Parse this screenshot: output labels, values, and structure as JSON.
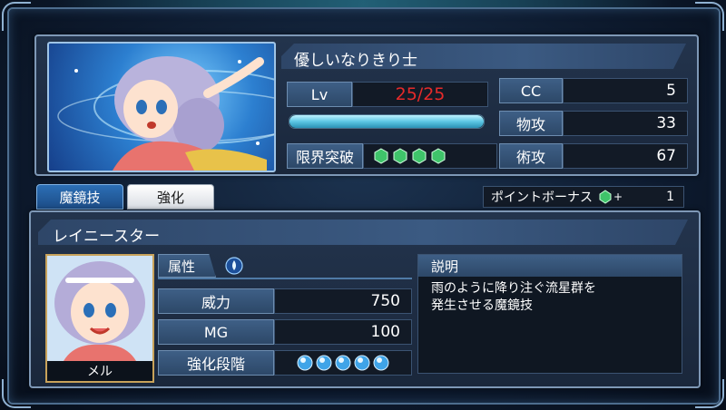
{
  "character": {
    "title": "優しいなりきり士",
    "level_label": "Lv",
    "level_value": "25/25",
    "exp_fraction": 1.0,
    "limit_break_label": "限界突破",
    "limit_break_count": 4,
    "cc_label": "CC",
    "cc_value": "5",
    "phys_atk_label": "物攻",
    "phys_atk_value": "33",
    "mag_atk_label": "術攻",
    "mag_atk_value": "67"
  },
  "tabs": {
    "skill_label": "魔鏡技",
    "enhance_label": "強化"
  },
  "bonus": {
    "label": "ポイントボーナス",
    "plus": "+",
    "value": "1"
  },
  "skill": {
    "name": "レイニースター",
    "character_name": "メル",
    "attribute_label": "属性",
    "attribute_icon": "water-drop-icon",
    "power_label": "威力",
    "power_value": "750",
    "mg_label": "MG",
    "mg_value": "100",
    "enhance_stage_label": "強化段階",
    "enhance_stage_count": 5,
    "description_label": "説明",
    "description_text": "雨のように降り注ぐ流星群を\n発生させる魔鏡技"
  },
  "colors": {
    "level_value": "#e52a2a",
    "gem": "#3fc46a",
    "orb": "#3fa4e8",
    "active_tab": "#2c6fb6"
  }
}
